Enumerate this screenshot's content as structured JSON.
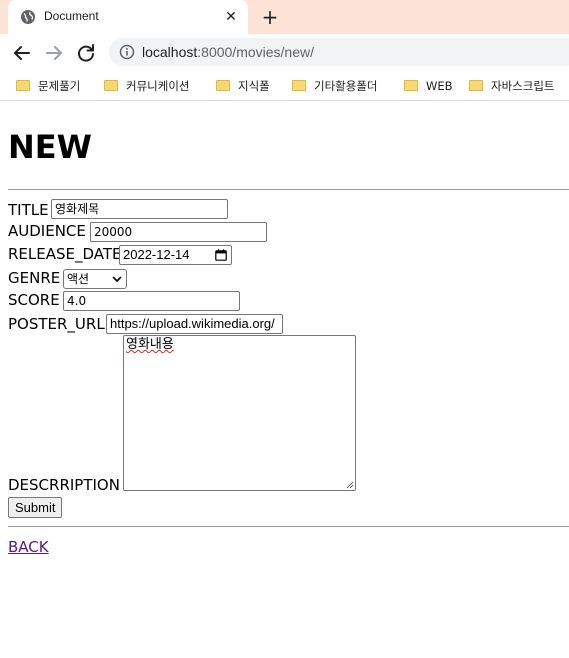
{
  "browser": {
    "tab_title": "Document",
    "new_tab_label": "+",
    "url_host": "localhost",
    "url_path": ":8000/movies/new/",
    "bookmarks": [
      "문제풀기",
      "커뮤니케이션",
      "지식폴",
      "기타활용폴더",
      "WEB",
      "자바스크립트"
    ]
  },
  "page": {
    "heading": "NEW",
    "labels": {
      "title": "TITLE",
      "audience": "AUDIENCE",
      "release_date": "RELEASE_DATE",
      "genre": "GENRE",
      "score": "SCORE",
      "poster_url": "POSTER_URL",
      "description": "DESCRRIPTION"
    },
    "values": {
      "title": "영화제목",
      "audience": "20000",
      "release_date": "2022-12-14",
      "genre": "액션",
      "score": "4.0",
      "poster_url": "https://upload.wikimedia.org/",
      "description": "영화내용"
    },
    "submit_label": "Submit",
    "back_label": "BACK"
  }
}
